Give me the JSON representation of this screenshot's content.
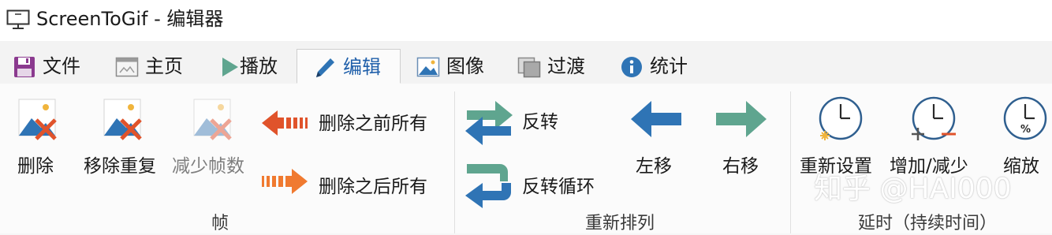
{
  "window": {
    "title": "ScreenToGif - 编辑器"
  },
  "tabs": [
    {
      "label": "文件",
      "icon": "floppy-disk-icon",
      "active": false
    },
    {
      "label": "主页",
      "icon": "home-window-icon",
      "active": false
    },
    {
      "label": "播放",
      "icon": "play-icon",
      "active": false
    },
    {
      "label": "编辑",
      "icon": "pencil-icon",
      "active": true
    },
    {
      "label": "图像",
      "icon": "image-icon",
      "active": false
    },
    {
      "label": "过渡",
      "icon": "transition-icon",
      "active": false
    },
    {
      "label": "统计",
      "icon": "info-icon",
      "active": false
    }
  ],
  "groups": {
    "frames": {
      "label": "帧",
      "delete": "删除",
      "remove_duplicates": "移除重复",
      "reduce_frame_count": "减少帧数",
      "delete_all_before": "删除之前所有",
      "delete_all_after": "删除之后所有"
    },
    "reorder": {
      "label": "重新排列",
      "reverse": "反转",
      "yoyo": "反转循环",
      "move_left": "左移",
      "move_right": "右移"
    },
    "delay": {
      "label": "延时（持续时间）",
      "override": "重新设置",
      "increase_decrease": "增加/减少",
      "scale": "缩放"
    }
  },
  "colors": {
    "accent_blue": "#2f74b5",
    "arrow_red": "#e0532b",
    "arrow_orange": "#f07a30",
    "teal": "#5fa58f",
    "gray_disabled": "#9a9a9a"
  },
  "watermark": "知乎 @HAI000"
}
